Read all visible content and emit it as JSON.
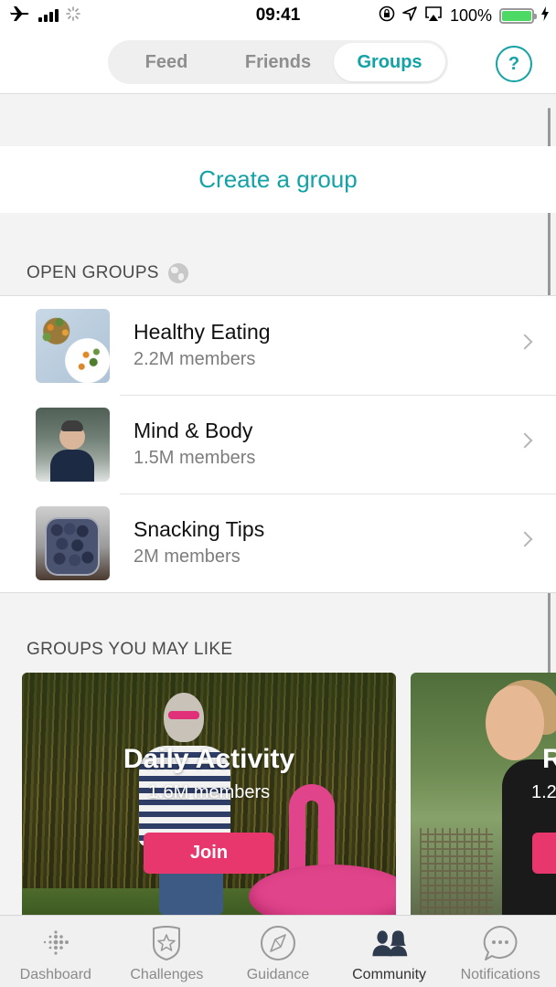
{
  "status_bar": {
    "time": "09:41",
    "battery_percent": "100%",
    "battery_level": 1.0,
    "left_icons": [
      "airplane-icon",
      "signal-icon",
      "loading-spinner-icon"
    ],
    "right_icons": [
      "rotation-lock-icon",
      "location-icon",
      "airplay-icon",
      "battery-icon",
      "charging-icon"
    ]
  },
  "header": {
    "tabs": [
      {
        "label": "Feed",
        "active": false
      },
      {
        "label": "Friends",
        "active": false
      },
      {
        "label": "Groups",
        "active": true
      }
    ],
    "help_label": "?"
  },
  "create_group": {
    "label": "Create a group"
  },
  "open_groups": {
    "title": "OPEN GROUPS",
    "icon": "globe-icon",
    "items": [
      {
        "name": "Healthy Eating",
        "members": "2.2M members",
        "thumb": "salad"
      },
      {
        "name": "Mind & Body",
        "members": "1.5M members",
        "thumb": "person-forest"
      },
      {
        "name": "Snacking Tips",
        "members": "2M members",
        "thumb": "blueberries-jar"
      }
    ]
  },
  "suggested_groups": {
    "title": "GROUPS YOU MAY LIKE",
    "cards": [
      {
        "name": "Daily Activity",
        "members": "1.6M members",
        "join_label": "Join"
      },
      {
        "name": "R",
        "members": "1.2",
        "join_label": ""
      }
    ]
  },
  "tab_bar": {
    "items": [
      {
        "label": "Dashboard",
        "icon": "dashboard-dots-icon",
        "active": false
      },
      {
        "label": "Challenges",
        "icon": "star-badge-icon",
        "active": false
      },
      {
        "label": "Guidance",
        "icon": "compass-icon",
        "active": false
      },
      {
        "label": "Community",
        "icon": "people-icon",
        "active": true
      },
      {
        "label": "Notifications",
        "icon": "chat-bubble-icon",
        "active": false
      }
    ]
  },
  "colors": {
    "accent": "#13a2a5",
    "join_button": "#e8376d",
    "battery": "#4cd964"
  }
}
